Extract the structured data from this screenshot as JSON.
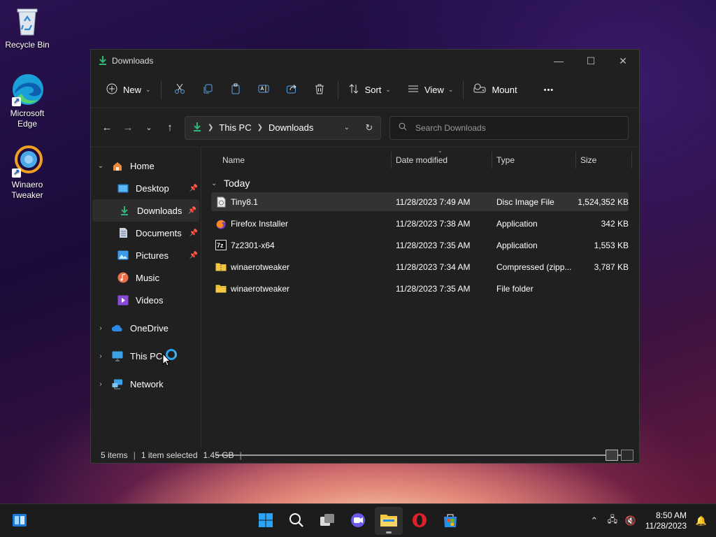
{
  "desktop": {
    "icons": [
      {
        "label": "Recycle Bin"
      },
      {
        "label": "Microsoft Edge"
      },
      {
        "label": "Winaero Tweaker"
      }
    ]
  },
  "window": {
    "title": "Downloads",
    "controls": {
      "minimize": "—",
      "maximize": "☐",
      "close": "✕"
    }
  },
  "toolbar": {
    "new_label": "New",
    "sort_label": "Sort",
    "view_label": "View",
    "mount_label": "Mount",
    "more_label": "•••"
  },
  "address": {
    "crumbs": [
      "This PC",
      "Downloads"
    ]
  },
  "search": {
    "placeholder": "Search Downloads"
  },
  "sidebar": {
    "home": "Home",
    "items": [
      {
        "label": "Desktop",
        "pinned": true
      },
      {
        "label": "Downloads",
        "pinned": true,
        "selected": true
      },
      {
        "label": "Documents",
        "pinned": true
      },
      {
        "label": "Pictures",
        "pinned": true
      },
      {
        "label": "Music"
      },
      {
        "label": "Videos"
      }
    ],
    "onedrive": "OneDrive",
    "thispc": "This PC",
    "network": "Network"
  },
  "columns": {
    "name": "Name",
    "date": "Date modified",
    "type": "Type",
    "size": "Size"
  },
  "group": {
    "label": "Today"
  },
  "files": [
    {
      "name": "Tiny8.1",
      "date": "11/28/2023 7:49 AM",
      "type": "Disc Image File",
      "size": "1,524,352 KB",
      "icon": "disc-image-icon",
      "selected": true
    },
    {
      "name": "Firefox Installer",
      "date": "11/28/2023 7:38 AM",
      "type": "Application",
      "size": "342 KB",
      "icon": "firefox-icon"
    },
    {
      "name": "7z2301-x64",
      "date": "11/28/2023 7:35 AM",
      "type": "Application",
      "size": "1,553 KB",
      "icon": "7zip-icon"
    },
    {
      "name": "winaerotweaker",
      "date": "11/28/2023 7:34 AM",
      "type": "Compressed (zipp...",
      "size": "3,787 KB",
      "icon": "zip-folder-icon"
    },
    {
      "name": "winaerotweaker",
      "date": "11/28/2023 7:35 AM",
      "type": "File folder",
      "size": "",
      "icon": "folder-icon"
    }
  ],
  "status": {
    "items": "5 items",
    "selected": "1 item selected",
    "size": "1.45 GB",
    "trailing_sep": "|"
  },
  "taskbar": {
    "time": "8:50 AM",
    "date": "11/28/2023"
  }
}
